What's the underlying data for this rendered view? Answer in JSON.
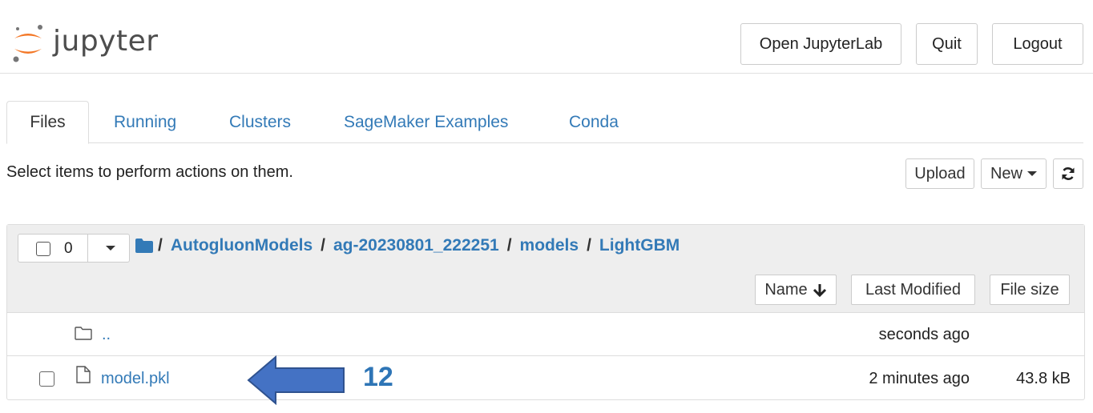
{
  "header": {
    "logo_text": "jupyter",
    "buttons": {
      "open_lab": "Open JupyterLab",
      "quit": "Quit",
      "logout": "Logout"
    }
  },
  "tabs": [
    {
      "label": "Files",
      "active": true
    },
    {
      "label": "Running",
      "active": false
    },
    {
      "label": "Clusters",
      "active": false
    },
    {
      "label": "SageMaker Examples",
      "active": false
    },
    {
      "label": "Conda",
      "active": false
    }
  ],
  "toolbar": {
    "info_text": "Select items to perform actions on them.",
    "upload": "Upload",
    "new": "New",
    "refresh_icon": "refresh-icon"
  },
  "file_list": {
    "selected_count": "0",
    "breadcrumb": [
      "AutogluonModels",
      "ag-20230801_222251",
      "models",
      "LightGBM"
    ],
    "sort_buttons": {
      "name": "Name",
      "last_modified": "Last Modified",
      "file_size": "File size"
    },
    "rows": [
      {
        "name": "..",
        "modified": "seconds ago",
        "size": "",
        "type": "folder"
      },
      {
        "name": "model.pkl",
        "modified": "2 minutes ago",
        "size": "43.8 kB",
        "type": "file"
      }
    ]
  },
  "annotation": {
    "label": "12",
    "color": "#4472c4"
  },
  "colors": {
    "link": "#337ab7",
    "logo_orange": "#f37726",
    "panel_header": "#eeeeee"
  }
}
